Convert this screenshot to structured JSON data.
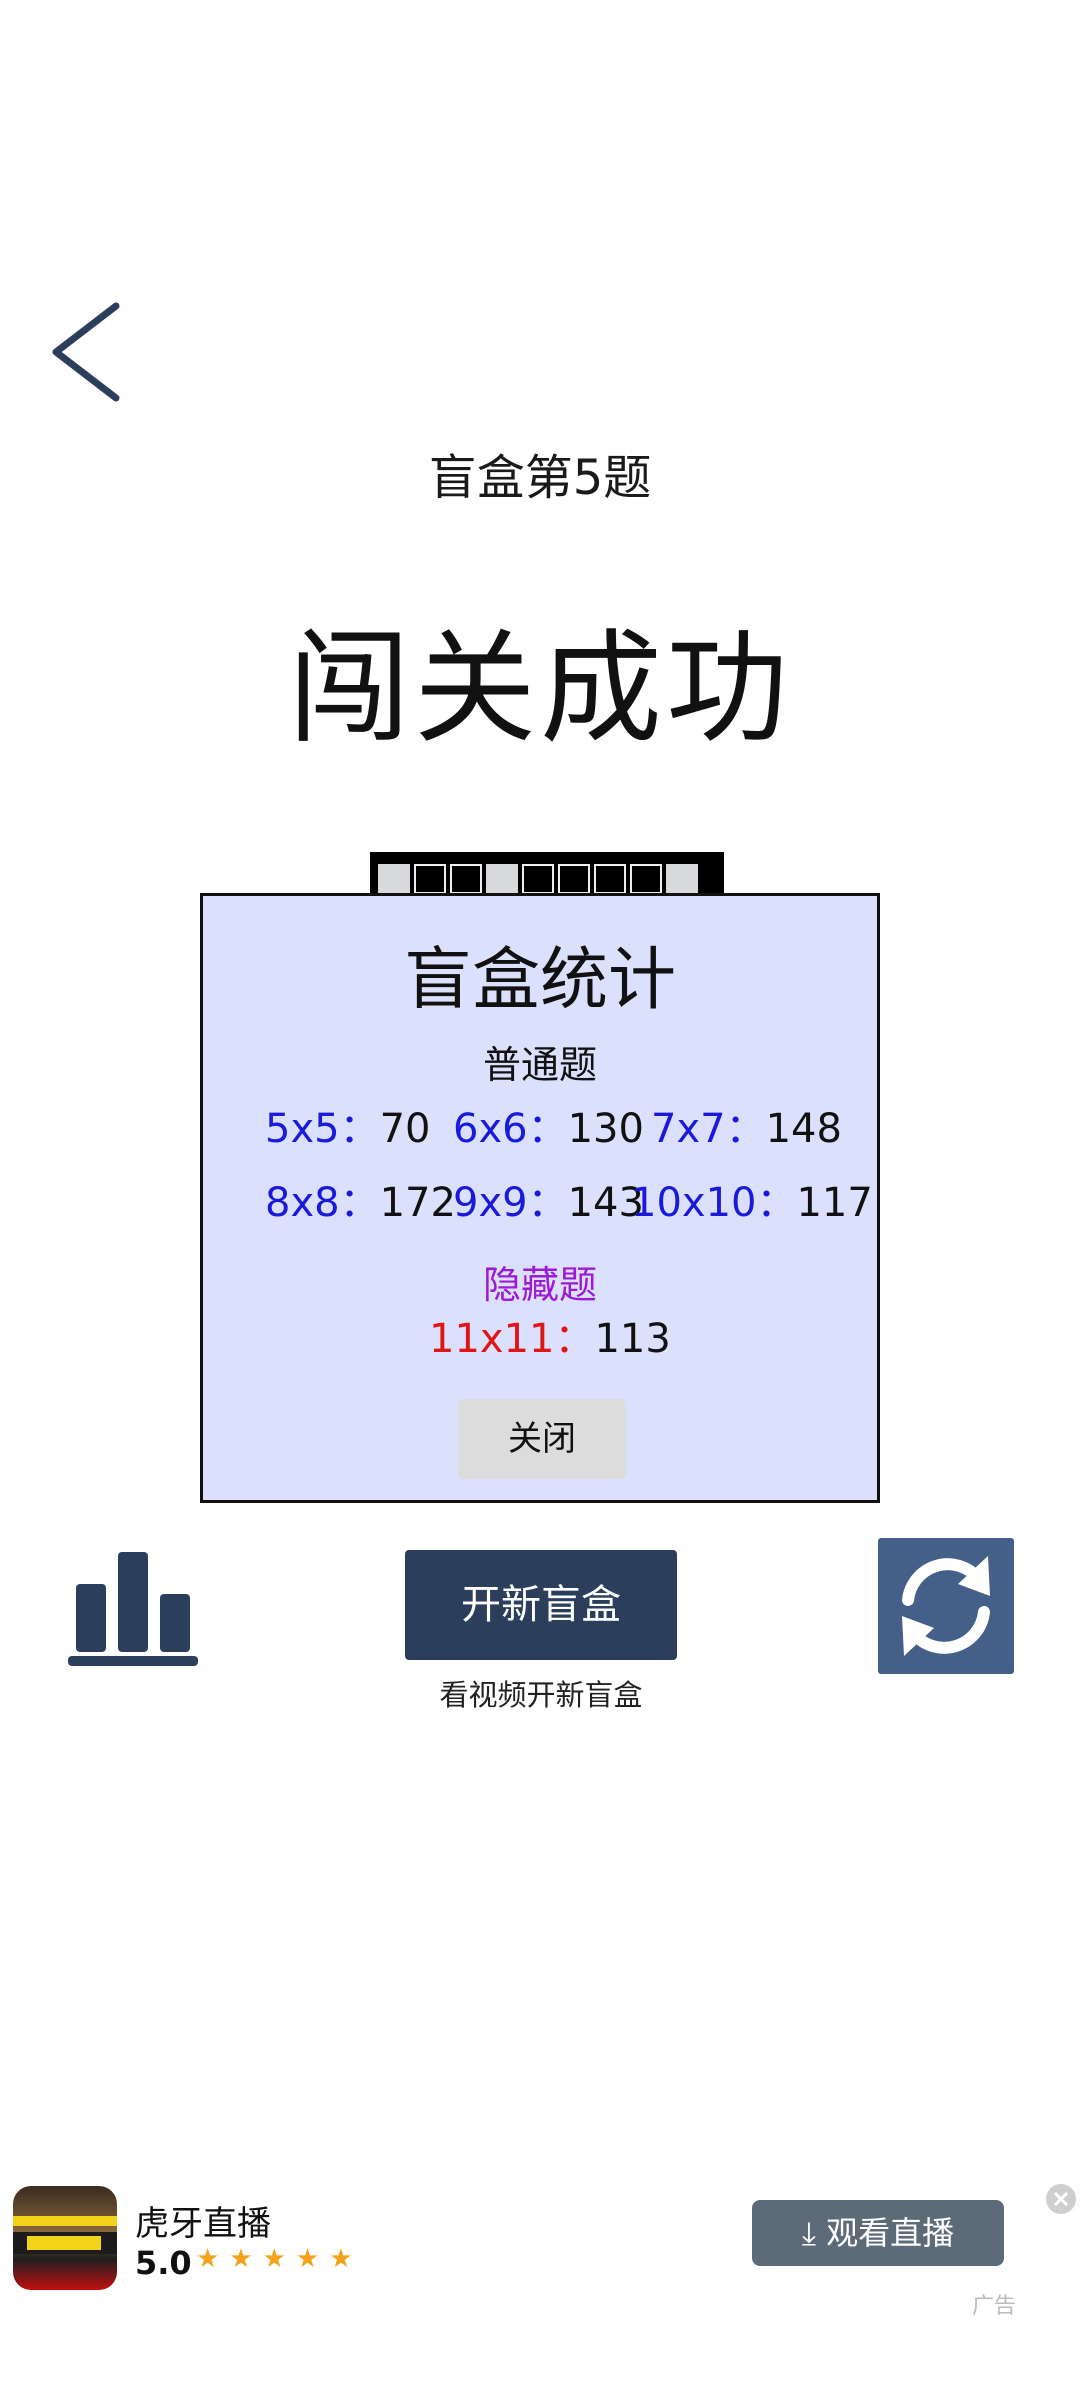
{
  "header": {
    "level_title": "盲盒第5题",
    "result_title": "闯关成功"
  },
  "dialog": {
    "title": "盲盒统计",
    "normal_label": "普通题",
    "hidden_label": "隐藏题",
    "stats": [
      {
        "key": "5x5：",
        "value": "70"
      },
      {
        "key": "6x6：",
        "value": "130"
      },
      {
        "key": "7x7：",
        "value": "148"
      },
      {
        "key": "8x8：",
        "value": "172"
      },
      {
        "key": "9x9：",
        "value": "143"
      },
      {
        "key": "10x10：",
        "value": "117"
      }
    ],
    "hidden_stats": [
      {
        "key": "11x11：",
        "value": "113"
      }
    ],
    "close_label": "关闭",
    "colors": {
      "background": "#dbe0fc",
      "key": "#1a1adc",
      "hidden_label": "#9b1bd6",
      "hidden_key": "#e01616"
    }
  },
  "actions": {
    "open_label": "开新盲盒",
    "open_sub": "看视频开新盲盒",
    "stats_icon": "bar-chart-icon",
    "refresh_icon": "refresh-icon",
    "accent": "#2b3e5c"
  },
  "ad": {
    "name": "虎牙直播",
    "rating": "5.0",
    "stars": "★★★★★",
    "cta": "观看直播",
    "tag": "广告",
    "cta_icon": "download-icon",
    "close_icon": "close-icon"
  }
}
